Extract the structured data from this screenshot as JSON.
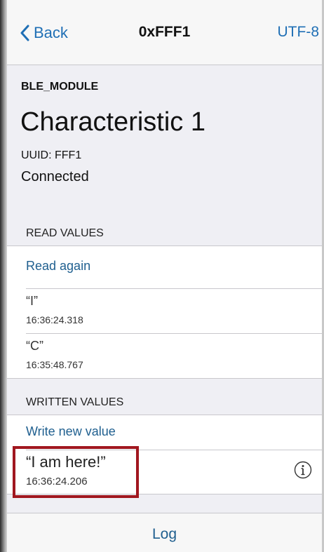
{
  "nav": {
    "back_label": "Back",
    "title": "0xFFF1",
    "encoding": "UTF-8"
  },
  "device": {
    "name": "BLE_MODULE"
  },
  "characteristic": {
    "name": "Characteristic 1",
    "uuid": "UUID: FFF1",
    "status": "Connected"
  },
  "read_section": {
    "header": "READ VALUES",
    "action": "Read again",
    "values": [
      {
        "value": "“I”",
        "time": "16:36:24.318"
      },
      {
        "value": "“C”",
        "time": "16:35:48.767"
      }
    ]
  },
  "written_section": {
    "header": "WRITTEN VALUES",
    "action": "Write new value",
    "values": [
      {
        "value": "“I am here!”",
        "time": "16:36:24.206"
      }
    ]
  },
  "footer": {
    "log_label": "Log"
  },
  "colors": {
    "accent": "#1f6fb5",
    "highlight": "#a1171f"
  }
}
